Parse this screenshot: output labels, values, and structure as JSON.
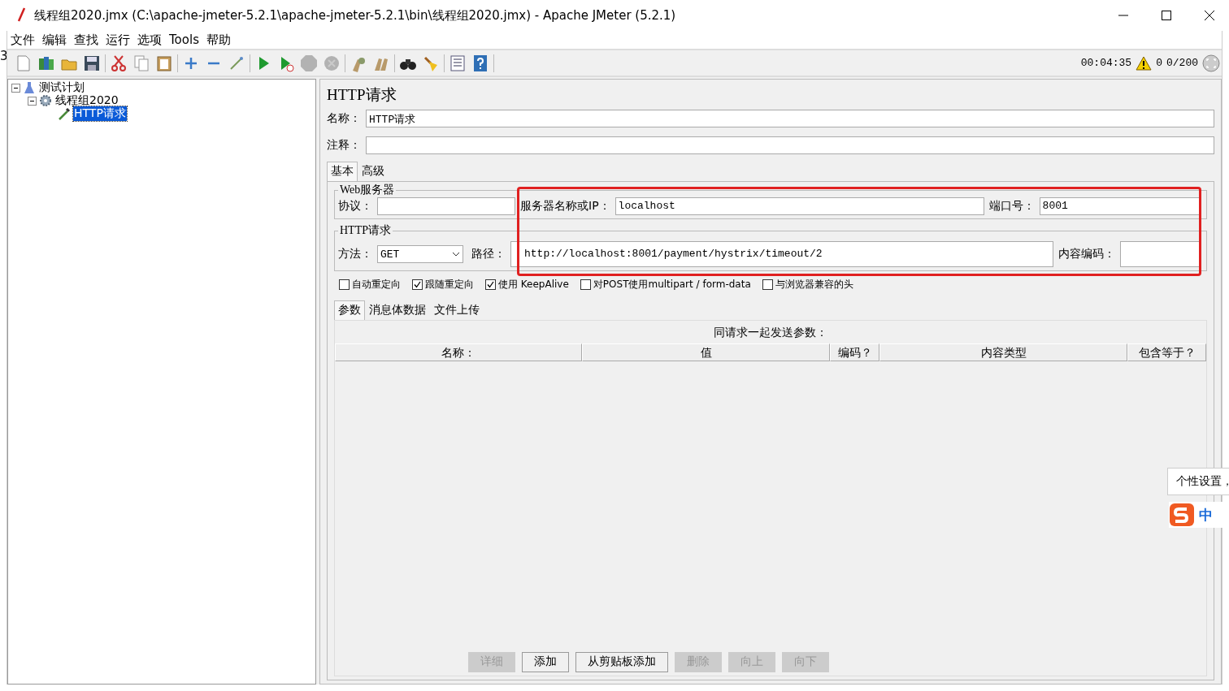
{
  "behind_text": "3",
  "window": {
    "title": "线程组2020.jmx (C:\\apache-jmeter-5.2.1\\apache-jmeter-5.2.1\\bin\\线程组2020.jmx) - Apache JMeter (5.2.1)"
  },
  "menu": [
    "文件",
    "编辑",
    "查找",
    "运行",
    "选项",
    "Tools",
    "帮助"
  ],
  "toolbar": [
    [
      {
        "kind": "new",
        "disabled": false
      },
      {
        "kind": "templates",
        "disabled": false
      },
      {
        "kind": "open",
        "disabled": false
      },
      {
        "kind": "save",
        "disabled": false
      }
    ],
    [
      {
        "kind": "cut",
        "disabled": false
      },
      {
        "kind": "copy",
        "disabled": false
      },
      {
        "kind": "paste",
        "disabled": false
      }
    ],
    [
      {
        "kind": "expand",
        "disabled": false
      },
      {
        "kind": "collapse",
        "disabled": false
      },
      {
        "kind": "toggle",
        "disabled": false
      }
    ],
    [
      {
        "kind": "start",
        "disabled": false
      },
      {
        "kind": "start-no-pause",
        "disabled": false
      },
      {
        "kind": "stop",
        "disabled": true
      },
      {
        "kind": "shutdown",
        "disabled": true
      }
    ],
    [
      {
        "kind": "clear",
        "disabled": false
      },
      {
        "kind": "clear-all",
        "disabled": false
      }
    ],
    [
      {
        "kind": "search",
        "disabled": false
      },
      {
        "kind": "reset-search",
        "disabled": false
      }
    ],
    [
      {
        "kind": "function-helper",
        "disabled": false
      },
      {
        "kind": "help",
        "disabled": false
      }
    ]
  ],
  "status": {
    "elapsed": "00:04:35",
    "warnings": "0",
    "threads": "0/200"
  },
  "tree": [
    {
      "label": "测试计划",
      "kind": "plan",
      "expanded": true,
      "selected": false,
      "children": [
        {
          "label": "线程组2020",
          "kind": "thread-group",
          "expanded": true,
          "selected": false,
          "children": [
            {
              "label": "HTTP请求",
              "kind": "sampler",
              "selected": true
            }
          ]
        }
      ]
    }
  ],
  "panel": {
    "title": "HTTP请求",
    "name_label": "名称：",
    "name_value": "HTTP请求",
    "comment_label": "注释："
  },
  "tabs": [
    {
      "label": "基本",
      "selected": true
    },
    {
      "label": "高级",
      "selected": false
    }
  ],
  "web_server": {
    "legend": "Web服务器",
    "protocol_label": "协议：",
    "server_label": "服务器名称或IP：",
    "server_value": "localhost",
    "port_label": "端口号：",
    "port_value": "8001"
  },
  "http_request": {
    "legend": "HTTP请求",
    "method_label": "方法：",
    "method_value": "GET",
    "path_label": "路径：",
    "path_value": "http://localhost:8001/payment/hystrix/timeout/2",
    "encoding_label": "内容编码："
  },
  "options": [
    {
      "label": "自动重定向",
      "checked": false
    },
    {
      "label": "跟随重定向",
      "checked": true
    },
    {
      "label": "使用 KeepAlive",
      "checked": true
    },
    {
      "label": "对POST使用multipart / form-data",
      "checked": false
    },
    {
      "label": "与浏览器兼容的头",
      "checked": false
    }
  ],
  "sub_tabs": [
    {
      "label": "参数",
      "selected": true
    },
    {
      "label": "消息体数据",
      "selected": false
    },
    {
      "label": "文件上传",
      "selected": false
    }
  ],
  "params_table": {
    "caption": "同请求一起发送参数：",
    "columns": [
      "名称：",
      "值",
      "编码？",
      "内容类型",
      "包含等于？"
    ]
  },
  "buttons": [
    {
      "label": "详细",
      "disabled": true
    },
    {
      "label": "添加",
      "disabled": false
    },
    {
      "label": "从剪贴板添加",
      "disabled": false
    },
    {
      "label": "删除",
      "disabled": true
    },
    {
      "label": "向上",
      "disabled": true
    },
    {
      "label": "向下",
      "disabled": true
    }
  ],
  "ime": {
    "tooltip": "个性设置，",
    "mode": "中"
  }
}
